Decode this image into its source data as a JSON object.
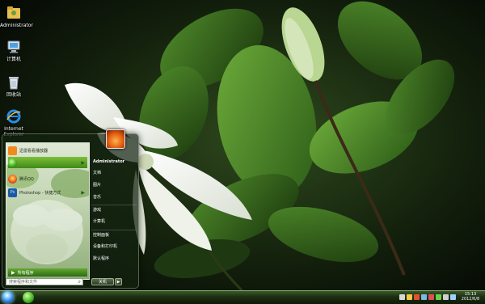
{
  "desktop": {
    "icons": [
      {
        "label": "Administrator",
        "icon": "user-folder-icon"
      },
      {
        "label": "计算机",
        "icon": "computer-icon"
      },
      {
        "label": "回收站",
        "icon": "recycle-bin-icon"
      },
      {
        "label": "Internet Explorer",
        "icon": "ie-icon"
      }
    ]
  },
  "start_menu": {
    "pinned": [
      {
        "label": "迅雷看看播放器",
        "icon": "xunlei-icon",
        "color": "#f08a1c"
      },
      {
        "label": "",
        "icon": "green-app-icon",
        "color": "#3fa11c",
        "highlighted": true
      },
      {
        "label": "腾讯QQ",
        "icon": "qq-icon",
        "color": "#e63a1c"
      },
      {
        "label": "Photoshop - 快捷方式",
        "icon": "photoshop-icon",
        "color": "#1c5aa8"
      }
    ],
    "all_programs": "所有程序",
    "search_placeholder": "搜索程序和文件",
    "user": "Administrator",
    "right_items": [
      "文档",
      "图片",
      "音乐",
      "游戏",
      "计算机",
      "控制面板",
      "设备和打印机",
      "默认程序"
    ],
    "shutdown": "关机"
  },
  "taskbar": {
    "time": "15:13",
    "date": "2012/6/8",
    "tray_colors": [
      "#d8d8d8",
      "#f2c84a",
      "#e94f2c",
      "#7ab8e6",
      "#e05050",
      "#6ad04a",
      "#d0d0d0",
      "#9fd1ff"
    ]
  }
}
